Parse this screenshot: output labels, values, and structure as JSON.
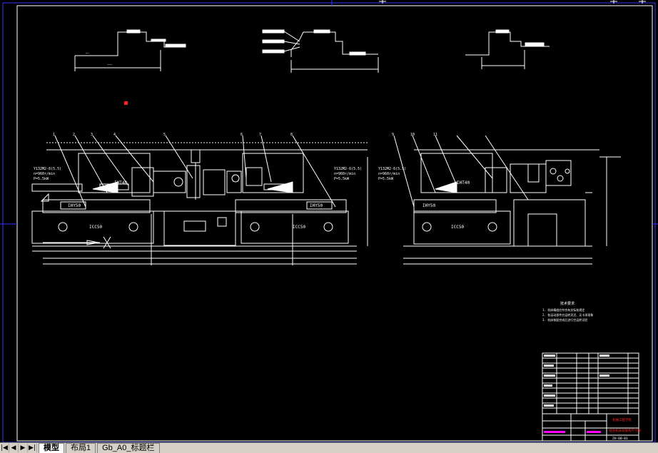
{
  "drawing": {
    "labels": {
      "head_left": "IHY50",
      "head_right": "IHY50",
      "head_side": "IHY50",
      "slide_left": "IHT40",
      "slide_side": "IHT40",
      "base_left": "ICC50",
      "base_right": "ICC50",
      "base_side": "ICC50"
    },
    "specs_left": [
      "Y132M2-6(5.5)",
      "n=960r/min",
      "P=5.5kW"
    ],
    "specs_right": [
      "Y132M2-6(5.5)",
      "n=960r/min",
      "P=5.5kW"
    ],
    "specs_side": [
      "Y132M2-6(5.5)",
      "n=960r/min",
      "P=5.5kW"
    ],
    "balloons": [
      "1",
      "2",
      "3",
      "4",
      "5",
      "6",
      "7",
      "8",
      "9",
      "10",
      "11"
    ],
    "notes_title": "技术要求",
    "notes": [
      "1. 机床精度应符合有关标准规定",
      "2. 各运动部件应运转灵活、无卡滞现象",
      "3. 机床装配完成后进行空运转试验"
    ],
    "title_block": {
      "school": "机械工程学院",
      "drawing_name": "组合机床总联系尺寸图",
      "drawing_no": "ZH-00-01"
    }
  },
  "tabs": [
    {
      "label": "模型",
      "active": true
    },
    {
      "label": "布局1",
      "active": false
    },
    {
      "label": "Gb_A0_标题栏",
      "active": false
    }
  ],
  "nav": [
    "|◀",
    "◀",
    "▶",
    "▶|"
  ],
  "colors": {
    "line": "#ffffff",
    "accent": "#ff00ff",
    "frame": "#3333ff",
    "title_red": "#ff2020"
  }
}
